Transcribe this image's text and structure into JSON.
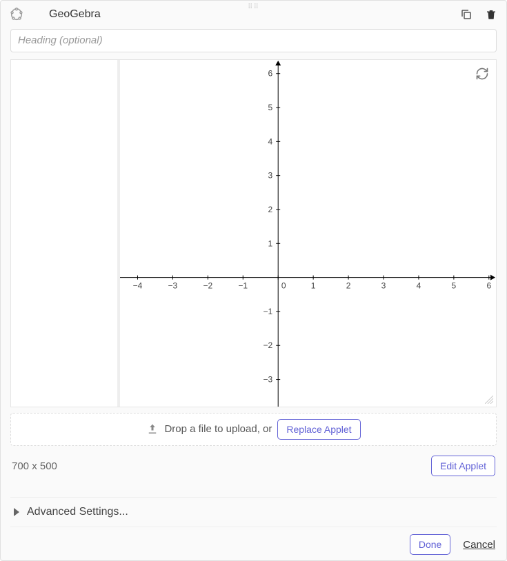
{
  "header": {
    "title": "GeoGebra",
    "copy_icon": "copy-icon",
    "delete_icon": "trash-icon"
  },
  "heading": {
    "placeholder": "Heading (optional)",
    "value": ""
  },
  "upload": {
    "prompt": "Drop a file to upload, or",
    "replace_label": "Replace Applet"
  },
  "dimensions": {
    "label": "700 x 500",
    "edit_label": "Edit Applet"
  },
  "advanced": {
    "label": "Advanced Settings..."
  },
  "footer": {
    "done_label": "Done",
    "cancel_label": "Cancel"
  },
  "chart_data": {
    "type": "scatter",
    "title": "",
    "xlabel": "",
    "ylabel": "",
    "xlim": [
      -4.5,
      6.2
    ],
    "ylim": [
      -3.8,
      6.4
    ],
    "xticks": [
      -4,
      -3,
      -2,
      -1,
      0,
      1,
      2,
      3,
      4,
      5,
      6
    ],
    "yticks": [
      -3,
      -2,
      -1,
      0,
      1,
      2,
      3,
      4,
      5,
      6
    ],
    "series": []
  }
}
